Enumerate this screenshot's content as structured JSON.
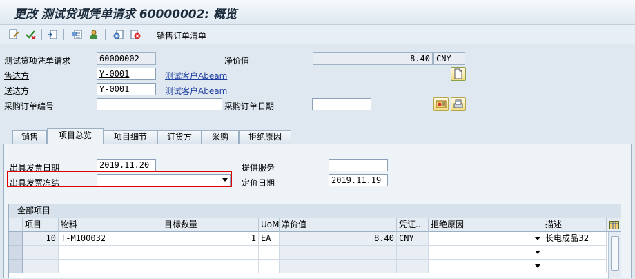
{
  "window": {
    "title": "更改 测试贷项凭单请求 60000002: 概览"
  },
  "toolbar": {
    "icons": [
      "display-change-icon",
      "check-icon",
      "create-doc-icon",
      "header-icon",
      "partner-icon",
      "config-icon",
      "reject-icon"
    ],
    "sales_order_list_label": "销售订单清单"
  },
  "header": {
    "doc_label": "测试贷项凭单请求",
    "doc_value": "60000002",
    "net_value_label": "净价值",
    "net_value": "8.40",
    "currency": "CNY",
    "sold_to_label": "售达方",
    "sold_to_value": "Y-0001",
    "sold_to_name": "测试客户Abeam",
    "ship_to_label": "送达方",
    "ship_to_value": "Y-0001",
    "ship_to_name": "测试客户Abeam",
    "po_number_label": "采购订单编号",
    "po_number_value": "",
    "po_date_label": "采购订单日期",
    "po_date_value": ""
  },
  "tabs": [
    {
      "label": "销售"
    },
    {
      "label": "项目总览"
    },
    {
      "label": "项目细节"
    },
    {
      "label": "订货方"
    },
    {
      "label": "采购"
    },
    {
      "label": "拒绝原因"
    }
  ],
  "overview": {
    "billing_date_label": "出具发票日期",
    "billing_date_value": "2019.11.20",
    "billing_block_label": "出具发票冻结",
    "billing_block_value": "",
    "service_label": "提供服务",
    "service_value": "",
    "pricing_date_label": "定价日期",
    "pricing_date_value": "2019.11.19"
  },
  "items_table": {
    "title": "全部项目",
    "columns": [
      "项目",
      "物料",
      "目标数量",
      "UoM",
      "净价值",
      "凭证...",
      "拒绝原因",
      "描述"
    ],
    "rows": [
      {
        "item": "10",
        "material": "T-M100032",
        "qty": "1",
        "uom": "EA",
        "net": "8.40",
        "currency": "CNY",
        "reject": "",
        "desc": "长电成品32"
      },
      {
        "item": "",
        "material": "",
        "qty": "",
        "uom": "",
        "net": "",
        "currency": "",
        "reject": "",
        "desc": ""
      },
      {
        "item": "",
        "material": "",
        "qty": "",
        "uom": "",
        "net": "",
        "currency": "",
        "reject": "",
        "desc": ""
      }
    ]
  }
}
